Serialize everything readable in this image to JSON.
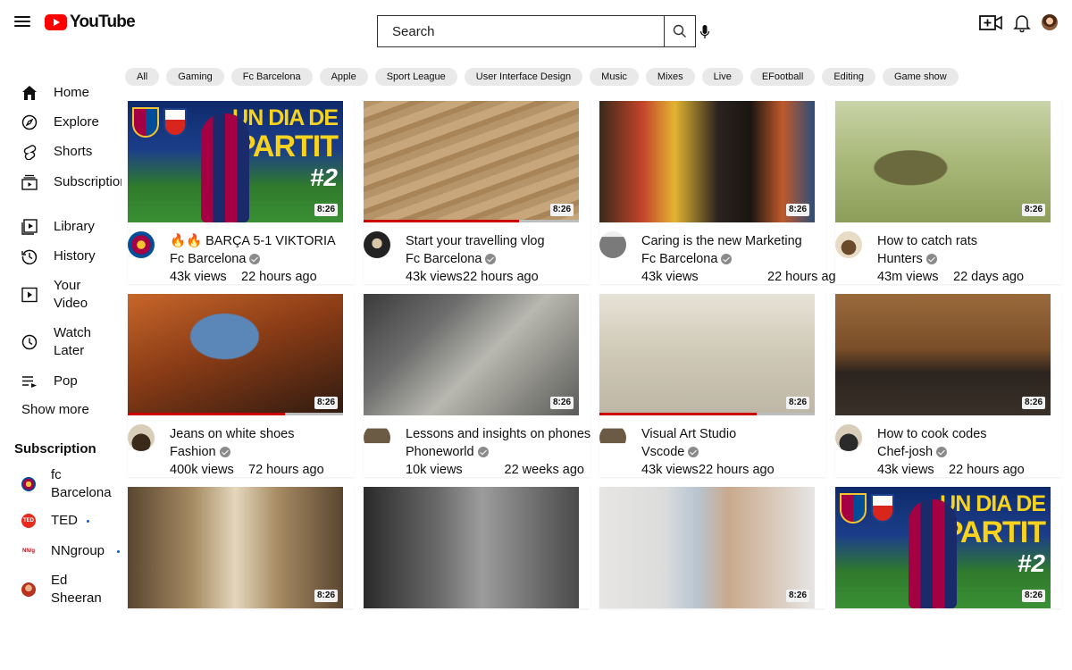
{
  "header": {
    "logo_text": "YouTube",
    "search_placeholder": "Search"
  },
  "chips": [
    "All",
    "Gaming",
    "Fc Barcelona",
    "Apple",
    "Sport League",
    "User Interface Design",
    "Music",
    "Mixes",
    "Live",
    "EFootball",
    "Editing",
    "Game show"
  ],
  "sidebar": {
    "items": [
      {
        "label": "Home",
        "icon": "home-icon"
      },
      {
        "label": "Explore",
        "icon": "compass-icon"
      },
      {
        "label": "Shorts",
        "icon": "shorts-icon"
      },
      {
        "label": "Subscriptions",
        "icon": "subscriptions-icon"
      },
      {
        "label": "Library",
        "icon": "library-icon"
      },
      {
        "label": "History",
        "icon": "history-icon"
      },
      {
        "label": "Your Video",
        "icon": "your-video-icon"
      },
      {
        "label": "Watch Later",
        "icon": "clock-icon"
      },
      {
        "label": "Pop",
        "icon": "playlist-icon"
      }
    ],
    "show_more": "Show more",
    "subscription_heading": "Subscription",
    "subscriptions": [
      {
        "label": "fc Barcelona",
        "live": false
      },
      {
        "label": "TED",
        "live": true
      },
      {
        "label": "NNgroup",
        "live": true
      },
      {
        "label": "Ed Sheeran",
        "live": false
      }
    ]
  },
  "videos": [
    {
      "title": "🔥🔥 BARÇA 5-1 VIKTORIA",
      "channel": "Fc Barcelona",
      "views": "43k views",
      "age": "22 hours ago",
      "duration": "8:26",
      "progress": 0
    },
    {
      "title": "Start your travelling vlog",
      "channel": "Fc Barcelona",
      "views": "43k views",
      "age": "22 hours ago",
      "duration": "8:26",
      "progress": 0.72
    },
    {
      "title": "Caring is the new Marketing",
      "channel": "Fc Barcelona",
      "views": "43k views",
      "age": "22 hours ago",
      "duration": "8:26",
      "progress": 0
    },
    {
      "title": "How to catch rats",
      "channel": "Hunters",
      "views": "43m views",
      "age": "22 days ago",
      "duration": "8:26",
      "progress": 0
    },
    {
      "title": "Jeans on white shoes",
      "channel": "Fashion",
      "views": "400k views",
      "age": "72 hours ago",
      "duration": "8:26",
      "progress": 0.73
    },
    {
      "title": "Lessons and insights on phones",
      "channel": "Phoneworld",
      "views": "10k views",
      "age": "22 weeks ago",
      "duration": "8:26",
      "progress": 0
    },
    {
      "title": "Visual Art Studio",
      "channel": "Vscode",
      "views": "43k views",
      "age": "22 hours ago",
      "duration": "8:26",
      "progress": 0.73
    },
    {
      "title": "How to cook codes",
      "channel": "Chef-josh",
      "views": "43k views",
      "age": "22 hours ago",
      "duration": "8:26",
      "progress": 0
    },
    {
      "duration": "8:26"
    },
    {
      "duration": ""
    },
    {
      "duration": "8:26"
    },
    {
      "duration": "8:26"
    }
  ],
  "thumb_overlay": {
    "line1": "UN DIA DE",
    "line2": "PARTIT",
    "badge": "#2"
  },
  "colors": {
    "brand_red": "#ff0000",
    "progress_red": "#cc0000",
    "chip_bg": "#e9e9e9"
  }
}
